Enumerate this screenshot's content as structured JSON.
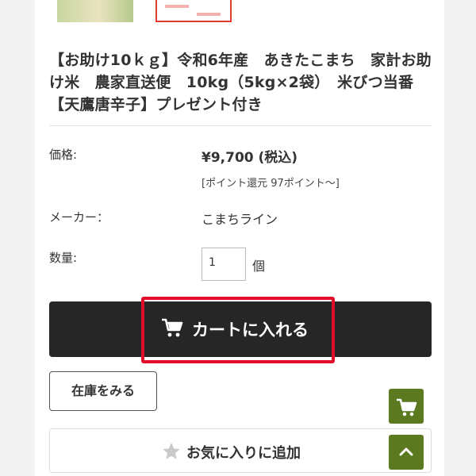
{
  "product": {
    "title": "【お助け10ｋｇ】令和6年産　あきたこまち　家計お助け米　農家直送便　10kg（5kg×2袋）　米びつ当番【天鷹唐辛子】プレゼント付き"
  },
  "details": {
    "price_label": "価格:",
    "price_value": "¥9,700 (税込)",
    "points_text": "[ポイント還元 97ポイント～]",
    "maker_label": "メーカー：",
    "maker_value": "こまちライン",
    "qty_label": "数量:",
    "qty_value": "1",
    "qty_unit": "個"
  },
  "actions": {
    "add_to_cart": "カートに入れる",
    "check_stock": "在庫をみる",
    "add_favorite": "お気に入りに追加"
  },
  "icons": {
    "cart": "cart-icon",
    "star": "star-icon",
    "floating_cart": "cart-icon",
    "scroll_top": "chevron-up-icon"
  },
  "colors": {
    "cart_button": "#262626",
    "highlight": "#e20d2b",
    "floating_buttons": "#5b7a1f"
  }
}
